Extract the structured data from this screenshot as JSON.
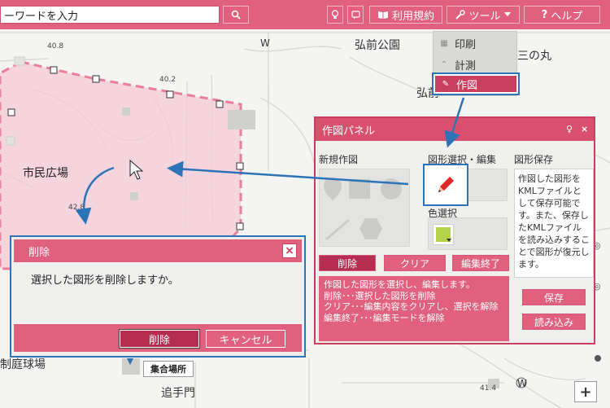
{
  "search": {
    "value": "ーワードを入力"
  },
  "topbar": {
    "terms_label": "利用規約",
    "tools_label": "ツール",
    "help_label": "ヘルプ"
  },
  "tool_menu": {
    "items": [
      {
        "label": "印刷",
        "icon": "print-icon"
      },
      {
        "label": "計測",
        "icon": "measure-icon"
      },
      {
        "label": "作図",
        "icon": "pencil-icon"
      }
    ]
  },
  "map": {
    "labels": {
      "park": "弘前公園",
      "sannomaru": "三の丸",
      "plaza": "市民広場",
      "outeumon": "追手門",
      "w1": "W",
      "w2": "W",
      "partial_right": "弘前",
      "stadium": "制庭球場",
      "elev1": "40.8",
      "elev2": "40.2",
      "elev3": "42.8",
      "elev4": "41.4"
    },
    "assembly_label": "集合場所",
    "zoom_in": "+"
  },
  "draw_panel": {
    "title": "作図パネル",
    "new_draw_title": "新規作図",
    "select_edit_title": "図形選択・編集",
    "save_title": "図形保存",
    "color_title": "色選択",
    "delete_label": "削除",
    "clear_label": "クリア",
    "end_edit_label": "編集終了",
    "help_lines": [
      "作図した図形を選択し、編集します。",
      "削除･･･選択した図形を削除",
      "クリア･･･編集内容をクリアし、選択を解除",
      "編集終了･･･編集モードを解除"
    ],
    "save_desc": "作図した図形をKMLファイルとして保存可能です。また、保存したKMLファイルを読み込みすることで図形が復元します。",
    "save_label": "保存",
    "load_label": "読み込み",
    "swatch_color": "#b5d34a"
  },
  "delete_dialog": {
    "title": "削除",
    "message": "選択した図形を削除しますか。",
    "delete_label": "削除",
    "cancel_label": "キャンセル"
  },
  "colors": {
    "brand_pink": "#e0607e",
    "accent_blue": "#2d73b8",
    "highlight_red": "#c93f5e"
  }
}
